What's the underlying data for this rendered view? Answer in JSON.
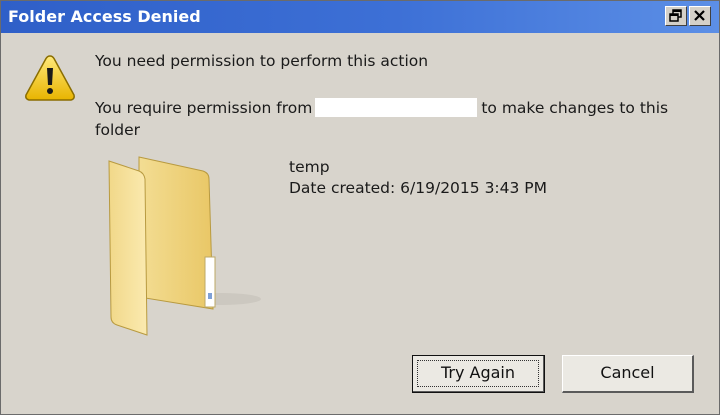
{
  "window": {
    "title": "Folder Access Denied",
    "title_bar_color": "#3566d0"
  },
  "titlebar_buttons": {
    "restore_icon": "restore-icon",
    "close_icon": "close-icon"
  },
  "message": {
    "icon": "warning-icon",
    "headline": "You need permission to perform this action",
    "detail_before": "You require permission from",
    "detail_after": "to make changes to this folder"
  },
  "item": {
    "icon": "folder-icon",
    "name": "temp",
    "date_created": "Date created: 6/19/2015 3:43 PM"
  },
  "buttons": {
    "try_again": "Try Again",
    "cancel": "Cancel"
  }
}
